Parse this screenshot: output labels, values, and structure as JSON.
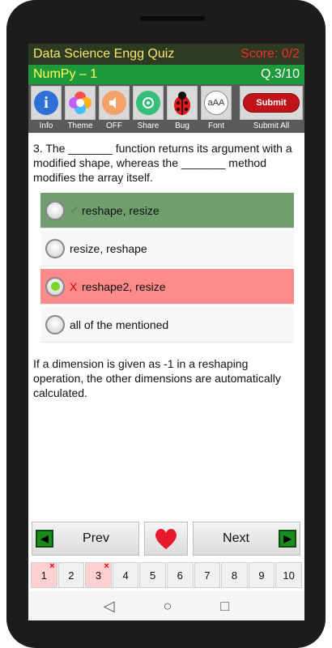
{
  "header": {
    "app_title": "Data Science Engg Quiz",
    "score": "Score: 0/2",
    "quiz_name": "NumPy – 1",
    "question_counter": "Q.3/10"
  },
  "toolbar": {
    "items": [
      {
        "label": "Info",
        "icon": "info-icon"
      },
      {
        "label": "Theme",
        "icon": "theme-icon"
      },
      {
        "label": "OFF",
        "icon": "sound-icon"
      },
      {
        "label": "Share",
        "icon": "share-icon"
      },
      {
        "label": "Bug",
        "icon": "bug-icon"
      },
      {
        "label": "Font",
        "icon": "font-icon"
      }
    ],
    "submit_button": "Submit",
    "submit_all_label": "Submit All"
  },
  "question": {
    "text": "3. The _______ function returns its argument with a modified shape, whereas the _______ method modifies the array itself."
  },
  "options": [
    {
      "text": "reshape, resize",
      "state": "correct",
      "mark": "✔"
    },
    {
      "text": "resize, reshape",
      "state": "normal",
      "mark": ""
    },
    {
      "text": "reshape2, resize",
      "state": "wrong",
      "mark": "X"
    },
    {
      "text": "all of the mentioned",
      "state": "normal",
      "mark": ""
    }
  ],
  "explanation": "If a dimension is given as -1 in a reshaping operation, the other dimensions are automatically calculated.",
  "nav": {
    "prev": "Prev",
    "next": "Next"
  },
  "pager": {
    "pages": [
      "1",
      "2",
      "3",
      "4",
      "5",
      "6",
      "7",
      "8",
      "9",
      "10"
    ],
    "wrong_mark": "×"
  },
  "colors": {
    "correct": "#6f9e6f",
    "wrong": "#ff8a8a",
    "header_dark": "#2b3a20",
    "header_green": "#1f9a3a"
  }
}
